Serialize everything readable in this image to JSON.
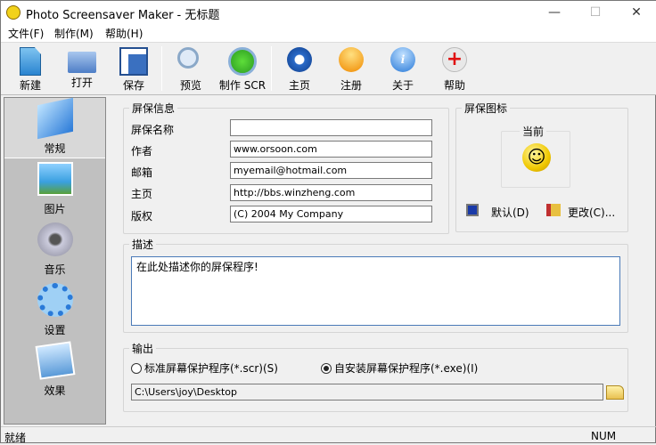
{
  "window": {
    "title": "Photo Screensaver Maker - 无标题",
    "minimize": "—",
    "maximize": "☐",
    "close": "✕"
  },
  "menu": [
    "文件(F)",
    "制作(M)",
    "帮助(H)"
  ],
  "toolbar": [
    {
      "label": "新建",
      "icon": "new-file-icon"
    },
    {
      "label": "打开",
      "icon": "open-folder-icon"
    },
    {
      "label": "保存",
      "icon": "save-disk-icon"
    },
    {
      "label": "预览",
      "icon": "magnifier-icon"
    },
    {
      "label": "制作 SCR",
      "icon": "play-icon"
    },
    {
      "label": "主页",
      "icon": "ie-icon"
    },
    {
      "label": "注册",
      "icon": "orange-ball-icon"
    },
    {
      "label": "关于",
      "icon": "info-icon"
    },
    {
      "label": "帮助",
      "icon": "help-cross-icon"
    }
  ],
  "sidebar": [
    {
      "label": "常规",
      "selected": true
    },
    {
      "label": "图片"
    },
    {
      "label": "音乐"
    },
    {
      "label": "设置"
    },
    {
      "label": "效果"
    }
  ],
  "info": {
    "legend": "屏保信息",
    "fields": [
      {
        "label": "屏保名称",
        "value": ""
      },
      {
        "label": "作者",
        "value": "www.orsoon.com"
      },
      {
        "label": "邮箱",
        "value": "myemail@hotmail.com"
      },
      {
        "label": "主页",
        "value": "http://bbs.winzheng.com"
      },
      {
        "label": "版权",
        "value": "(C) 2004 My Company"
      }
    ]
  },
  "icon_panel": {
    "legend": "屏保图标",
    "current": "当前",
    "default_btn": "默认(D)",
    "change_btn": "更改(C)..."
  },
  "desc": {
    "legend": "描述",
    "value": "在此处描述你的屏保程序!"
  },
  "output": {
    "legend": "输出",
    "opt1": "标准屏幕保护程序(*.scr)(S)",
    "opt2": "自安装屏幕保护程序(*.exe)(I)",
    "selected": 2,
    "path": "C:\\Users\\joy\\Desktop"
  },
  "status": {
    "left": "就绪",
    "right": "NUM"
  }
}
